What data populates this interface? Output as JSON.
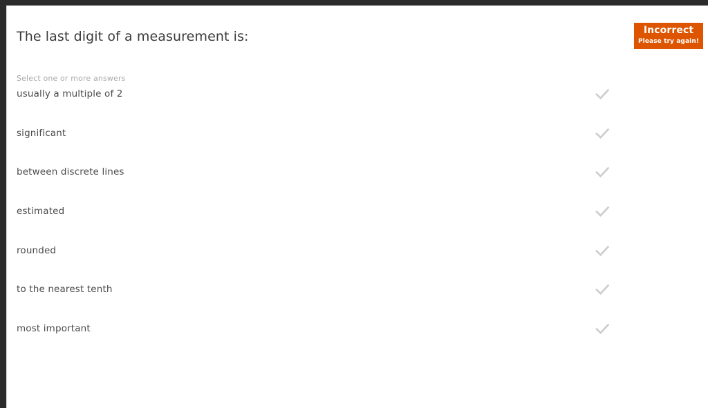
{
  "window": {
    "frame_color": "#2b2b2b",
    "surface_color": "#ffffff"
  },
  "question": {
    "title": "The last digit of a measurement is:",
    "hint": "Select one or more answers",
    "options": [
      {
        "label": "usually a multiple of 2",
        "check_icon": "check-icon"
      },
      {
        "label": "significant",
        "check_icon": "check-icon"
      },
      {
        "label": "between discrete lines",
        "check_icon": "check-icon"
      },
      {
        "label": "estimated",
        "check_icon": "check-icon"
      },
      {
        "label": "rounded",
        "check_icon": "check-icon"
      },
      {
        "label": "to the nearest tenth",
        "check_icon": "check-icon"
      },
      {
        "label": "most important",
        "check_icon": "check-icon"
      }
    ]
  },
  "feedback": {
    "title": "Incorrect",
    "subtitle": "Please try again!",
    "background_color": "#dd5500",
    "text_color": "#ffffff"
  },
  "colors": {
    "title_text": "#3a3a3a",
    "option_text": "#4a4a4a",
    "hint_text": "#a8a8a8",
    "check_mark": "#cccccc"
  }
}
